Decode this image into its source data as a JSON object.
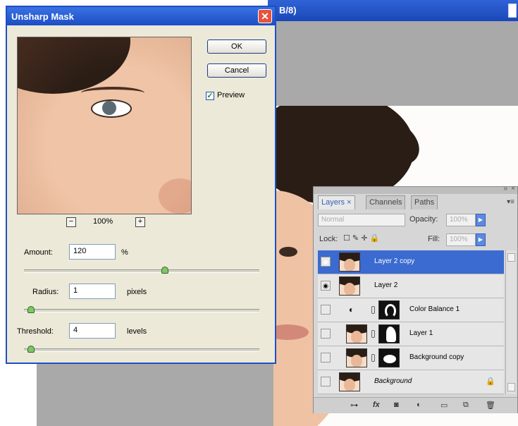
{
  "document": {
    "title_fragment": "B/8)"
  },
  "dialog": {
    "title": "Unsharp Mask",
    "close_symbol": "✕",
    "ok_label": "OK",
    "cancel_label": "Cancel",
    "preview_label": "Preview",
    "preview_checked": true,
    "zoom_out_symbol": "−",
    "zoom_in_symbol": "+",
    "zoom_level": "100%",
    "amount": {
      "label": "Amount:",
      "value": "120",
      "unit": "%",
      "slider_fraction": 0.6
    },
    "radius": {
      "label": "Radius:",
      "value": "1",
      "unit": "pixels",
      "slider_fraction": 0.03
    },
    "threshold": {
      "label": "Threshold:",
      "value": "4",
      "unit": "levels",
      "slider_fraction": 0.03
    }
  },
  "layers_panel": {
    "tabs": [
      {
        "label": "Layers ×"
      },
      {
        "label": "Channels"
      },
      {
        "label": "Paths"
      }
    ],
    "blend_mode": "Normal",
    "opacity_label": "Opacity:",
    "opacity_value": "100%",
    "lock_label": "Lock:",
    "fill_label": "Fill:",
    "fill_value": "100%",
    "layers": [
      {
        "name": "Layer 2 copy",
        "visible": true,
        "selected": true
      },
      {
        "name": "Layer 2",
        "visible": true,
        "selected": false
      },
      {
        "name": "Color Balance 1",
        "visible": false,
        "selected": false
      },
      {
        "name": "Layer 1",
        "visible": false,
        "selected": false
      },
      {
        "name": "Background copy",
        "visible": false,
        "selected": false
      },
      {
        "name": "Background",
        "visible": false,
        "selected": false
      }
    ],
    "footer_icons": [
      "link-icon",
      "fx-icon",
      "mask-icon",
      "adjustment-icon",
      "folder-icon",
      "new-layer-icon",
      "trash-icon"
    ]
  }
}
